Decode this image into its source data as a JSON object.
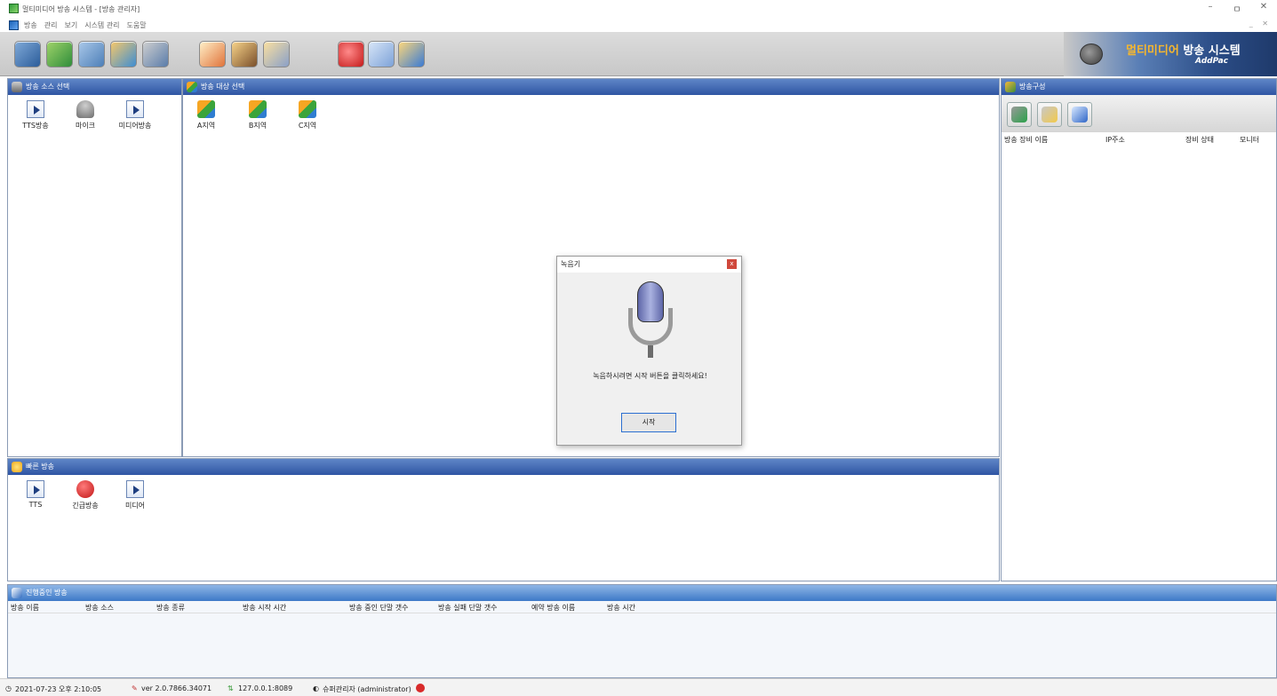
{
  "window": {
    "title": "멀티미디어 방송 시스템 - [방송 관리자]",
    "min": "–",
    "max": "ㅁ",
    "close": "✕"
  },
  "menu": [
    "방송",
    "관리",
    "보기",
    "시스템 관리",
    "도움말"
  ],
  "mdi_controls": "_ ✕",
  "logo": {
    "text_orange": "멀티미디어",
    "text_white": " 방송 시스템",
    "sub": "AddPac"
  },
  "source_panel": {
    "title": "방송 소스 선택",
    "items": [
      "TTS방송",
      "마이크",
      "미디어방송"
    ]
  },
  "target_panel": {
    "title": "방송 대상 선택",
    "items": [
      "A지역",
      "B지역",
      "C지역"
    ]
  },
  "config_panel": {
    "title": "방송구성",
    "columns": [
      "방송 장비 이름",
      "IP주소",
      "장비 상태",
      "모니터"
    ]
  },
  "quick_panel": {
    "title": "빠른 방송",
    "items": [
      "TTS",
      "긴급방송",
      "미디어"
    ]
  },
  "active_panel": {
    "title": "진행중인 방송",
    "columns": [
      "방송 이름",
      "방송 소스",
      "방송 종류",
      "방송 시작 시간",
      "방송 중인 단말 갯수",
      "방송 실패 단말 갯수",
      "예약 방송 이름",
      "방송 시간"
    ]
  },
  "status": {
    "datetime": "2021-07-23 오후 2:10:05",
    "version": "ver 2.0.7866.34071",
    "server": "127.0.0.1:8089",
    "user": "슈퍼관리자 (administrator)"
  },
  "dialog": {
    "title": "녹음기",
    "close": "x",
    "message": "녹음하시려면 시작 버튼을 클릭하세요!",
    "start_button": "시작"
  }
}
